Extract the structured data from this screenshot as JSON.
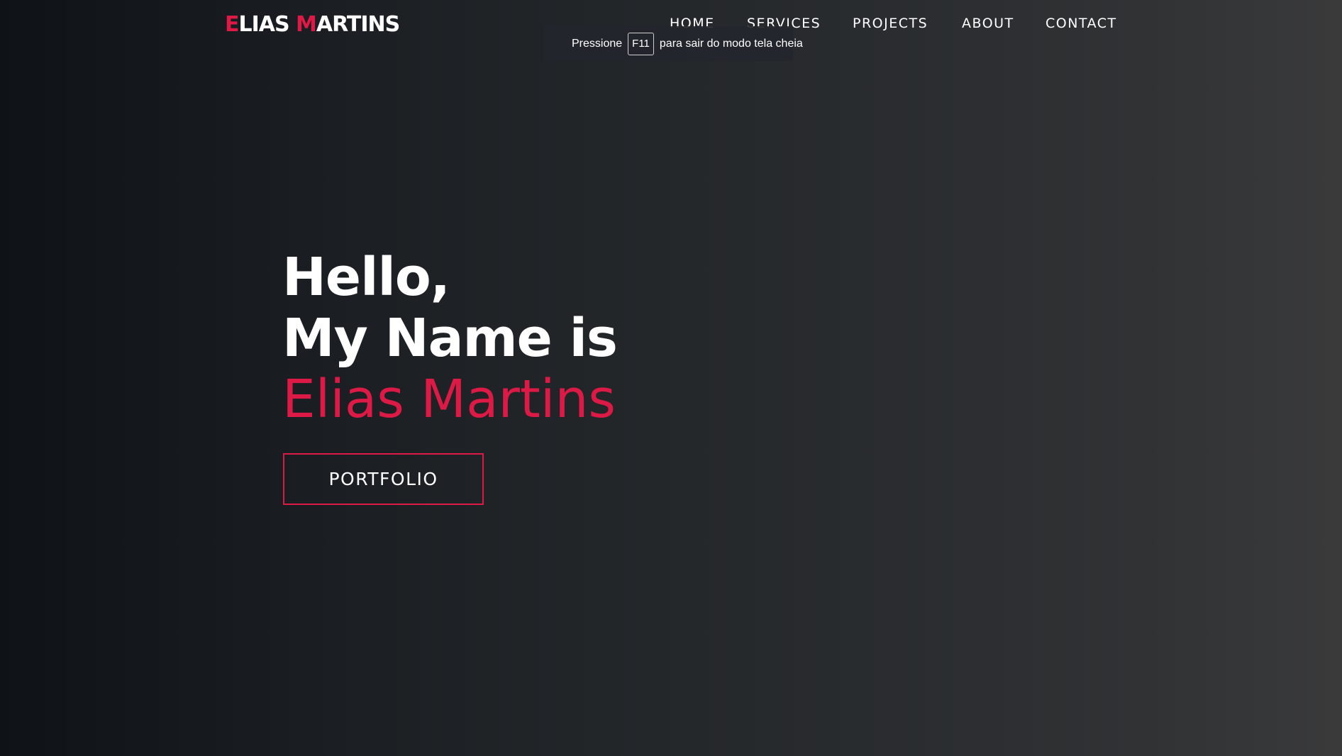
{
  "header": {
    "logo": {
      "part1_accent": "E",
      "part1_rest": "LIAS ",
      "part2_accent": "M",
      "part2_rest": "ARTINS"
    },
    "nav": [
      {
        "label": "HOME"
      },
      {
        "label": "SERVICES"
      },
      {
        "label": "PROJECTS"
      },
      {
        "label": "ABOUT"
      },
      {
        "label": "CONTACT"
      }
    ]
  },
  "fullscreen_hint": {
    "before": "Pressione",
    "key": "F11",
    "after": "para sair do modo tela cheia"
  },
  "hero": {
    "line1": "Hello,",
    "line2": "My Name is",
    "name": "Elias Martins",
    "button_label": "PORTFOLIO"
  },
  "colors": {
    "accent": "#dc1a45",
    "text": "#ffffff",
    "background_dark": "#0f1317",
    "background_light": "#3a3a3b"
  }
}
